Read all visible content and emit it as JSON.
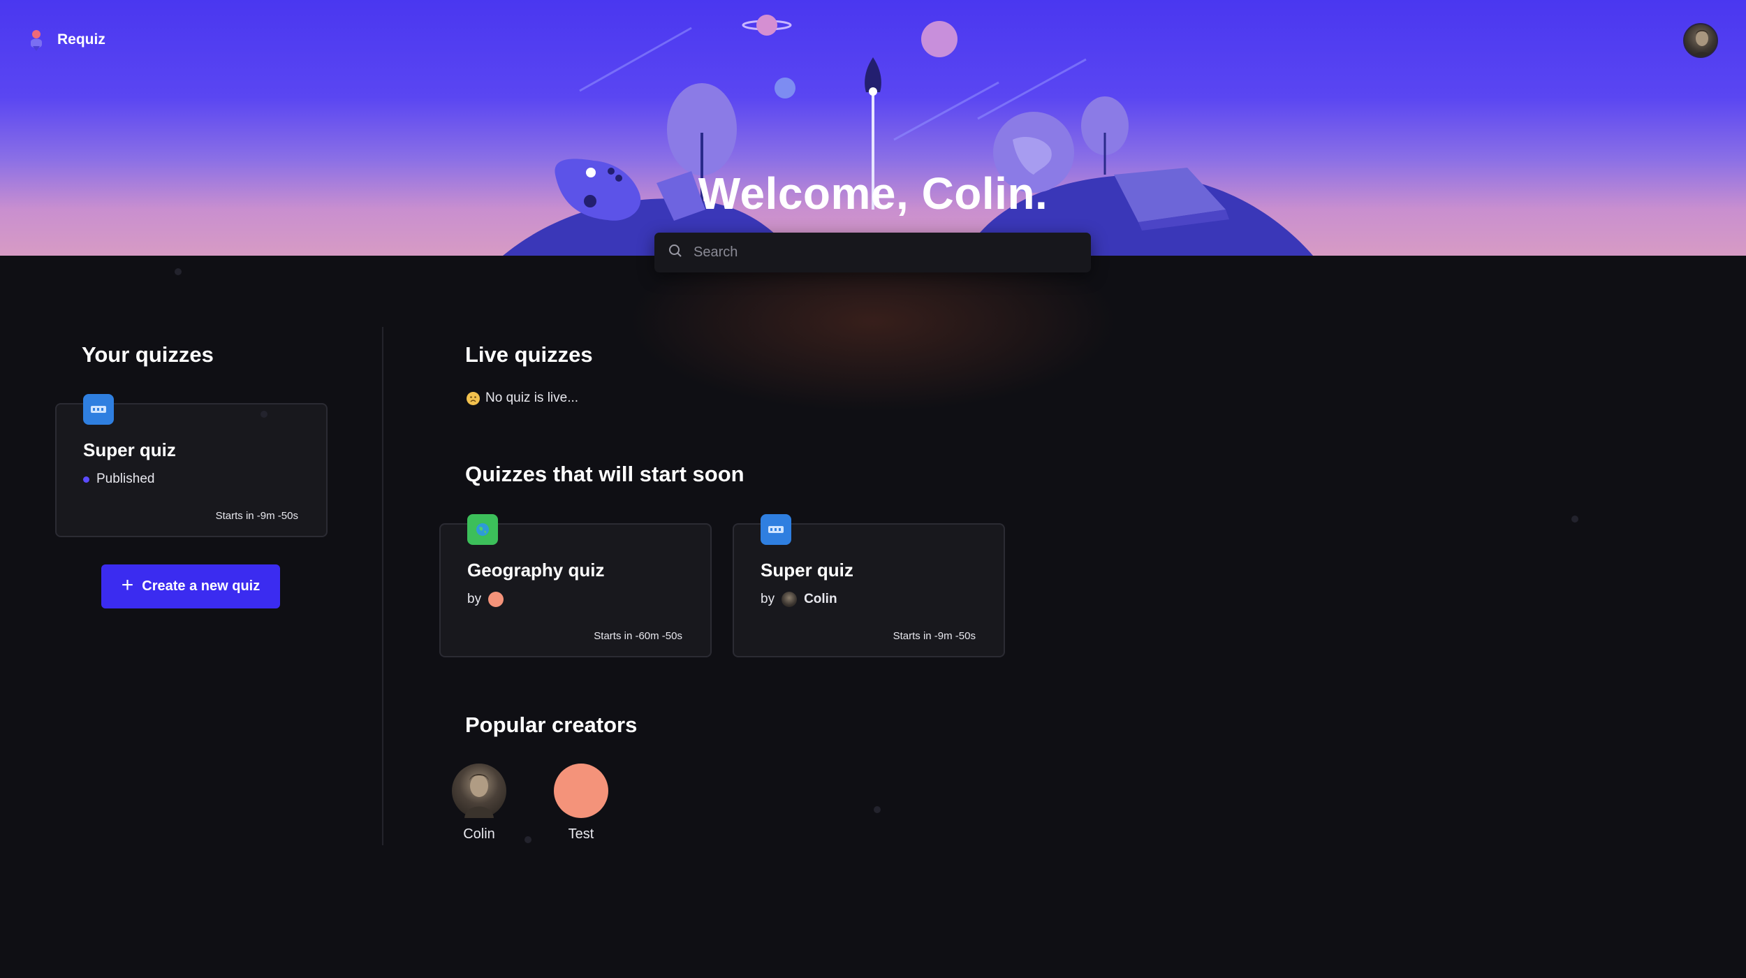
{
  "app": {
    "name": "Requiz"
  },
  "header": {
    "welcome": "Welcome, Colin."
  },
  "search": {
    "placeholder": "Search"
  },
  "your_quizzes": {
    "title": "Your quizzes",
    "cards": [
      {
        "title": "Super quiz",
        "status": "Published",
        "time": "Starts in -9m -50s",
        "icon": "film-icon",
        "icon_color": "#2f7fe0"
      }
    ],
    "create_label": "Create a new quiz"
  },
  "live_quizzes": {
    "title": "Live quizzes",
    "empty": "No quiz is live..."
  },
  "soon": {
    "title": "Quizzes that will start soon",
    "by_label": "by",
    "cards": [
      {
        "title": "Geography quiz",
        "author": "",
        "time": "Starts in -60m -50s",
        "icon": "globe-icon",
        "icon_color": "#3cbf5a"
      },
      {
        "title": "Super quiz",
        "author": "Colin",
        "time": "Starts in -9m -50s",
        "icon": "film-icon",
        "icon_color": "#2f7fe0"
      }
    ]
  },
  "creators": {
    "title": "Popular creators",
    "items": [
      {
        "name": "Colin"
      },
      {
        "name": "Test"
      }
    ]
  },
  "colors": {
    "accent": "#3b2cf0",
    "peach": "#f4937a",
    "background": "#0f0f14"
  }
}
